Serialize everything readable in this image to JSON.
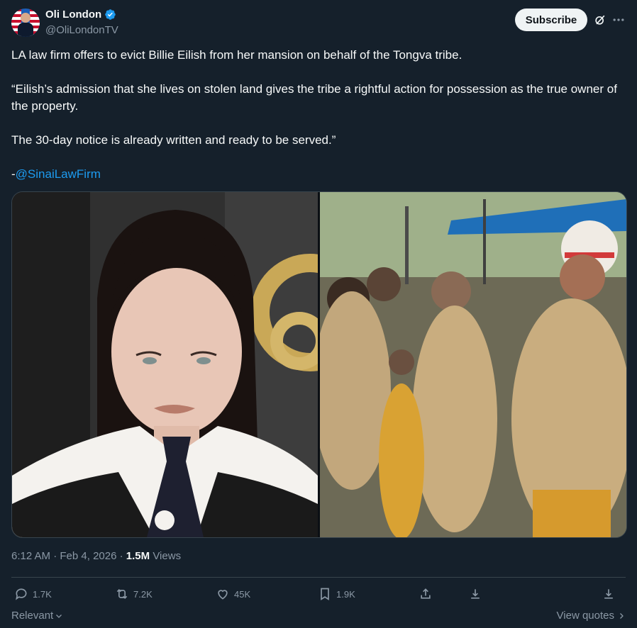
{
  "author": {
    "name": "Oli London",
    "handle": "@OliLondonTV",
    "verified_color": "#1d9bf0"
  },
  "header": {
    "subscribe_label": "Subscribe",
    "icons": [
      "grok-icon",
      "more-icon"
    ]
  },
  "tweet": {
    "line1": "LA law firm offers to evict Billie Eilish from her mansion on behalf of the Tongva tribe.",
    "line2": "“Eilish’s admission that she lives on stolen land gives the tribe a rightful action for possession as the true owner of the property.",
    "line3": "The 30-day notice is already written and ready to be served.”",
    "signature_prefix": "-",
    "mention": "@SinaiLawFirm"
  },
  "meta": {
    "time": "6:12 AM",
    "separator": " · ",
    "date": "Feb 4, 2026",
    "dot": " · ",
    "views_count": "1.5M",
    "views_label": " Views"
  },
  "actions": {
    "replies": "1.7K",
    "reposts": "7.2K",
    "likes": "45K",
    "bookmarks": "1.9K"
  },
  "footer": {
    "sort_label": "Relevant",
    "view_quotes_label": "View quotes"
  },
  "colors": {
    "background": "#15202b",
    "accent": "#1d9bf0",
    "muted": "#8b98a5"
  }
}
